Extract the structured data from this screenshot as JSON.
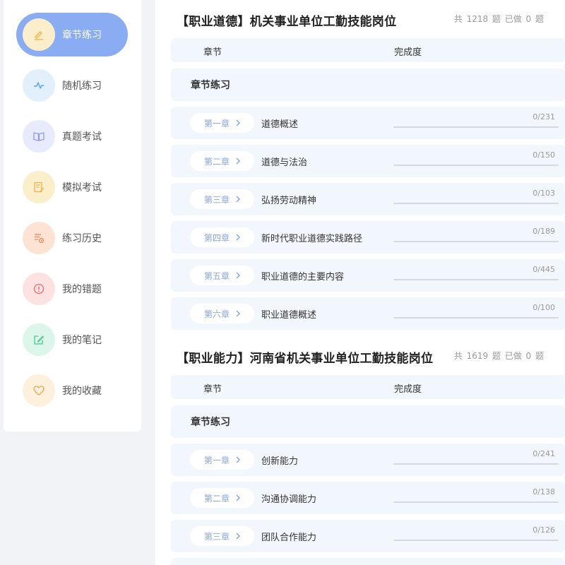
{
  "sidebar": {
    "items": [
      {
        "label": "章节练习",
        "icon": "pencil-icon",
        "bg": "#fbeecb",
        "color": "#f2b44a",
        "active": true
      },
      {
        "label": "随机练习",
        "icon": "pulse-icon",
        "bg": "#e2f0fb",
        "color": "#5ba3e8",
        "active": false
      },
      {
        "label": "真题考试",
        "icon": "book-icon",
        "bg": "#e8ebfd",
        "color": "#8e9bf0",
        "active": false
      },
      {
        "label": "模拟考试",
        "icon": "edit-doc-icon",
        "bg": "#fbeecb",
        "color": "#f0b04a",
        "active": false
      },
      {
        "label": "练习历史",
        "icon": "history-list-icon",
        "bg": "#fde3d3",
        "color": "#f08a5a",
        "active": false
      },
      {
        "label": "我的错题",
        "icon": "alert-circle-icon",
        "bg": "#fde2e2",
        "color": "#ec6f6f",
        "active": false
      },
      {
        "label": "我的笔记",
        "icon": "note-edit-icon",
        "bg": "#ddf6ea",
        "color": "#4dc98b",
        "active": false
      },
      {
        "label": "我的收藏",
        "icon": "heart-icon",
        "bg": "#fdf0dd",
        "color": "#f2a54a",
        "active": false
      }
    ]
  },
  "sections": [
    {
      "title": "【职业道德】机关事业单位工勤技能岗位",
      "stats": "共 1218 题 已做 0 题",
      "header": {
        "chapter": "章节",
        "progress": "完成度"
      },
      "group": "章节练习",
      "chapters": [
        {
          "tag": "第一章",
          "name": "道德概述",
          "done": 0,
          "total": 231,
          "count": "0/231"
        },
        {
          "tag": "第二章",
          "name": "道德与法治",
          "done": 0,
          "total": 150,
          "count": "0/150"
        },
        {
          "tag": "第三章",
          "name": "弘扬劳动精神",
          "done": 0,
          "total": 103,
          "count": "0/103"
        },
        {
          "tag": "第四章",
          "name": "新时代职业道德实践路径",
          "done": 0,
          "total": 189,
          "count": "0/189"
        },
        {
          "tag": "第五章",
          "name": "职业道德的主要内容",
          "done": 0,
          "total": 445,
          "count": "0/445"
        },
        {
          "tag": "第六章",
          "name": "职业道德概述",
          "done": 0,
          "total": 100,
          "count": "0/100"
        }
      ]
    },
    {
      "title": "【职业能力】河南省机关事业单位工勤技能岗位",
      "stats": "共 1619 题 已做 0 题",
      "header": {
        "chapter": "章节",
        "progress": "完成度"
      },
      "group": "章节练习",
      "chapters": [
        {
          "tag": "第一章",
          "name": "创新能力",
          "done": 0,
          "total": 241,
          "count": "0/241"
        },
        {
          "tag": "第二章",
          "name": "沟通协调能力",
          "done": 0,
          "total": 138,
          "count": "0/138"
        },
        {
          "tag": "第三章",
          "name": "团队合作能力",
          "done": 0,
          "total": 126,
          "count": "0/126"
        }
      ]
    }
  ],
  "colors": {
    "accent": "#8aacf3",
    "row_bg": "#f2f7fd",
    "page_bg": "#f1f3f7"
  }
}
